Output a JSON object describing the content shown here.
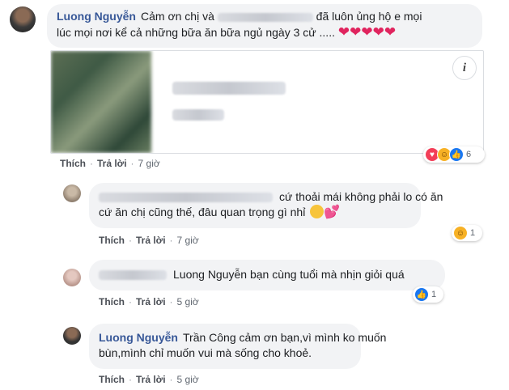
{
  "comments": [
    {
      "author": "Luong Nguyễn",
      "text_1": "Cảm ơn chị và",
      "text_2": "đã luôn ủng hộ e mọi",
      "text_3": "lúc mọi nơi kể cả những bữa ăn bữa ngủ ngày 3 cử .....",
      "hearts": "❤❤❤❤❤",
      "reactions": [
        "love",
        "haha",
        "like"
      ],
      "reaction_count": "6",
      "like": "Thích",
      "reply": "Trả lời",
      "time": "7 giờ"
    },
    {
      "text_1": "cứ thoải mái không phải lo có ăn",
      "text_2": "cứ ăn chị cũng thế, đâu quan trọng gì nhỉ",
      "reactions": [
        "haha"
      ],
      "reaction_count": "1",
      "like": "Thích",
      "reply": "Trả lời",
      "time": "7 giờ"
    },
    {
      "text_1": "Luong Nguyễn bạn cùng tuổi mà nhịn giỏi quá",
      "reactions": [
        "like"
      ],
      "reaction_count": "1",
      "like": "Thích",
      "reply": "Trả lời",
      "time": "5 giờ"
    },
    {
      "author": "Luong Nguyễn",
      "text_1": "Trần Công cảm ơn bạn,vì mình ko muốn",
      "text_2": "bùn,mình chỉ muốn vui mà sống cho khoẻ.",
      "like": "Thích",
      "reply": "Trả lời",
      "time": "5 giờ"
    }
  ],
  "preview": {
    "info_icon": "i"
  },
  "colors": {
    "author": "#385898",
    "bubble": "#f2f3f5",
    "love": "#f33e58",
    "haha": "#f7b125",
    "like": "#1877f2"
  }
}
